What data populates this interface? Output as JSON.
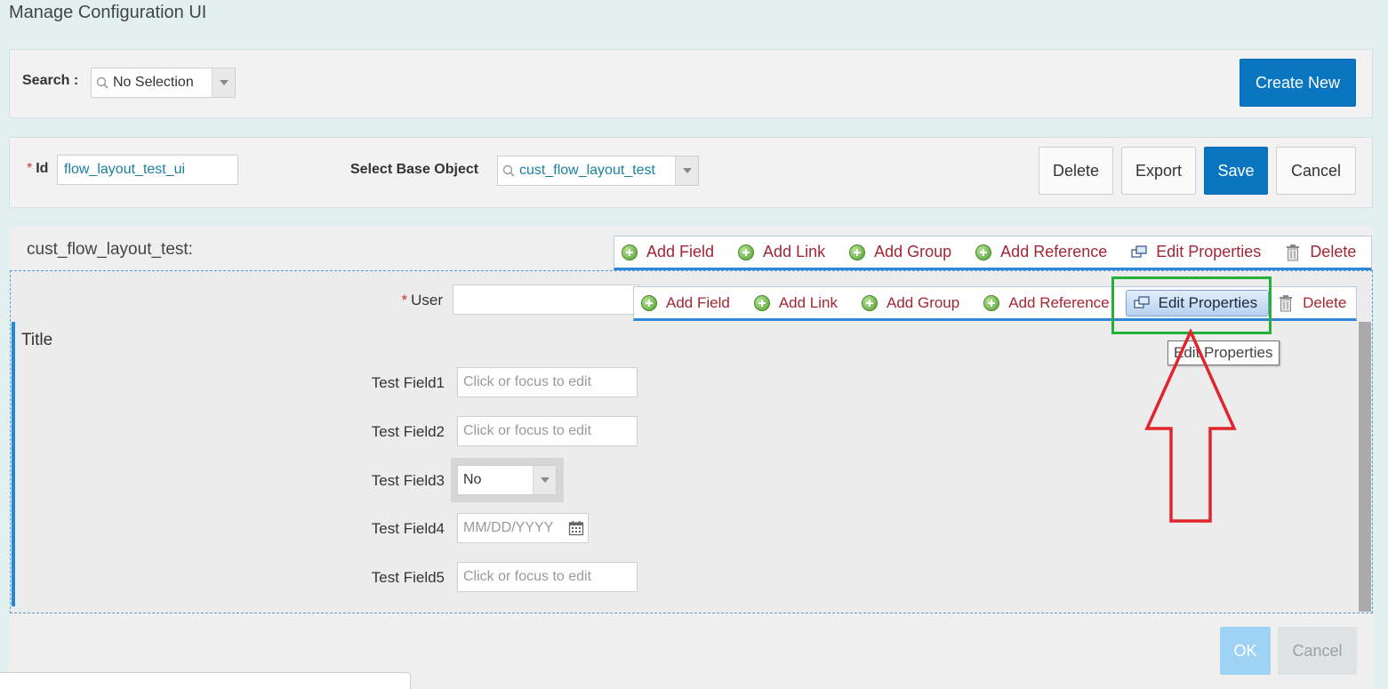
{
  "page": {
    "title": "Manage Configuration UI"
  },
  "search": {
    "label": "Search :",
    "value": "No Selection"
  },
  "create_new": "Create New",
  "record": {
    "id_label": "Id",
    "id_value": "flow_layout_test_ui",
    "base_object_label": "Select Base Object",
    "base_object_value": "cust_flow_layout_test"
  },
  "actions": {
    "delete": "Delete",
    "export": "Export",
    "save": "Save",
    "cancel": "Cancel"
  },
  "section": {
    "title": "cust_flow_layout_test:"
  },
  "toolbar_outer": {
    "add_field": "Add Field",
    "add_link": "Add Link",
    "add_group": "Add Group",
    "add_reference": "Add Reference",
    "edit_properties": "Edit Properties",
    "delete": "Delete"
  },
  "toolbar_inner": {
    "add_field": "Add Field",
    "add_link": "Add Link",
    "add_group": "Add Group",
    "add_reference": "Add Reference",
    "edit_properties": "Edit Properties",
    "delete": "Delete"
  },
  "tooltip": "Edit Properties",
  "form": {
    "user_label": "User",
    "group_title": "Title",
    "fields": [
      {
        "label": "Test Field1",
        "placeholder": "Click or focus to edit"
      },
      {
        "label": "Test Field2",
        "placeholder": "Click or focus to edit"
      },
      {
        "label": "Test Field3",
        "value": "No"
      },
      {
        "label": "Test Field4",
        "placeholder": "MM/DD/YYYY"
      },
      {
        "label": "Test Field5",
        "placeholder": "Click or focus to edit"
      }
    ]
  },
  "footer": {
    "ok": "OK",
    "cancel": "Cancel"
  },
  "colors": {
    "primary": "#0a76c2",
    "link": "#a52633",
    "highlight_box": "#22b03a",
    "arrow": "#e0262c"
  },
  "icons": [
    "search-icon",
    "add-icon",
    "edit-properties-icon",
    "trash-icon",
    "calendar-icon",
    "dropdown-arrow-icon"
  ]
}
